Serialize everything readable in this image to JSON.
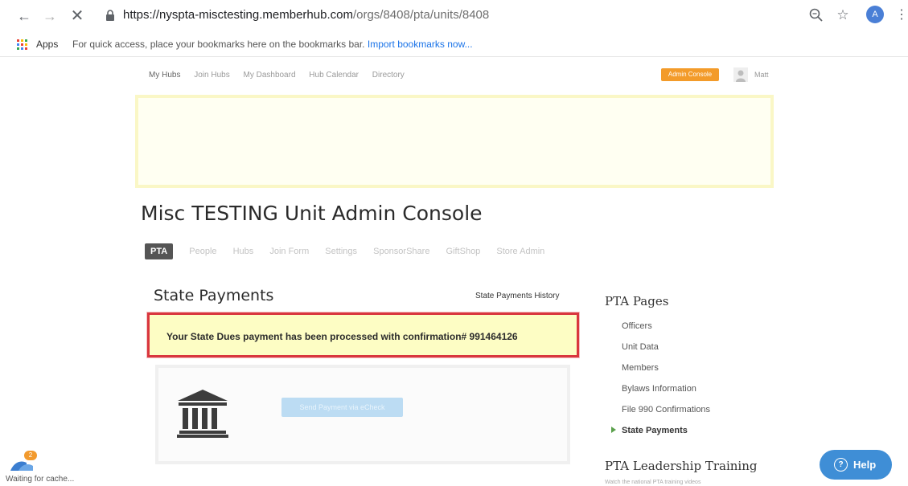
{
  "browser": {
    "url_host": "https://nyspta-misctesting.memberhub.com",
    "url_path": "/orgs/8408/pta/units/8408",
    "bookmarks": {
      "apps_label": "Apps",
      "hint": "For quick access, place your bookmarks here on the bookmarks bar.",
      "import_link": "Import bookmarks now..."
    },
    "profile_initial": "A",
    "status_text": "Waiting for cache...",
    "notification_count": "2",
    "icons": [
      "back-arrow-icon",
      "forward-arrow-icon",
      "stop-loading-icon",
      "lock-icon",
      "zoom-icon",
      "star-icon",
      "menu-dots-icon",
      "apps-grid-icon"
    ]
  },
  "site": {
    "nav": [
      "My Hubs",
      "Join Hubs",
      "My Dashboard",
      "Hub Calendar",
      "Directory"
    ],
    "admin_console_label": "Admin Console",
    "user_name": "Matt"
  },
  "page": {
    "title": "Misc TESTING Unit Admin Console",
    "tabs": [
      "PTA",
      "People",
      "Hubs",
      "Join Form",
      "Settings",
      "SponsorShare",
      "GiftShop",
      "Store Admin"
    ]
  },
  "payments": {
    "title": "State Payments",
    "history_link": "State Payments History",
    "confirmation_message": "Your State Dues payment has been processed with confirmation# 991464126",
    "echeck_button": "Send Payment via eCheck"
  },
  "sidebar": {
    "title": "PTA Pages",
    "items": [
      "Officers",
      "Unit Data",
      "Members",
      "Bylaws Information",
      "File 990 Confirmations",
      "State Payments"
    ],
    "active_item": "State Payments",
    "training_title": "PTA Leadership Training",
    "training_sub": "Watch the national PTA training videos"
  },
  "help": {
    "label": "Help"
  },
  "colors": {
    "accent_orange": "#f39b2a",
    "alert_border": "#d9363e",
    "alert_background": "#fdfdc4",
    "help_blue": "#3f8ed6",
    "active_bullet": "#5aa04b"
  }
}
